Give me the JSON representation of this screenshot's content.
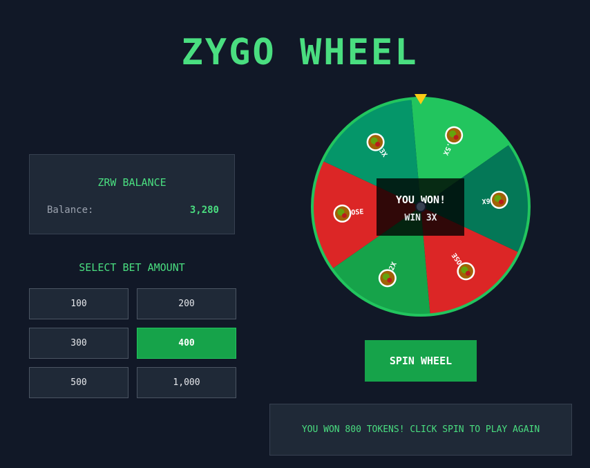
{
  "title": "ZYGO WHEEL",
  "balance": {
    "heading": "ZRW BALANCE",
    "label": "Balance:",
    "value": "3,280"
  },
  "bet": {
    "heading": "SELECT BET AMOUNT",
    "options": [
      "100",
      "200",
      "300",
      "400",
      "500",
      "1,000"
    ],
    "selected": "400"
  },
  "wheel": {
    "segments": [
      {
        "label": "1.5X",
        "color": "#22c55e",
        "has_icon": true
      },
      {
        "label": "6X",
        "color": "#047857",
        "has_icon": true
      },
      {
        "label": "LOSE",
        "color": "#dc2626",
        "has_icon": true
      },
      {
        "label": "2X",
        "color": "#16a34a",
        "has_icon": true
      },
      {
        "label": "LOSE",
        "color": "#dc2626",
        "has_icon": true
      },
      {
        "label": "3X",
        "color": "#059669",
        "has_icon": true
      }
    ],
    "rim_color": "#22c55e",
    "pointer_color": "#facc15",
    "result": {
      "title": "YOU WON!",
      "subtitle": "WIN 3X"
    }
  },
  "spin_label": "SPIN WHEEL",
  "status_message": "YOU WON 800 TOKENS! CLICK SPIN TO PLAY AGAIN",
  "colors": {
    "accent": "#4ade80",
    "background": "#111827",
    "panel": "#1f2937",
    "button_active": "#16a34a"
  }
}
